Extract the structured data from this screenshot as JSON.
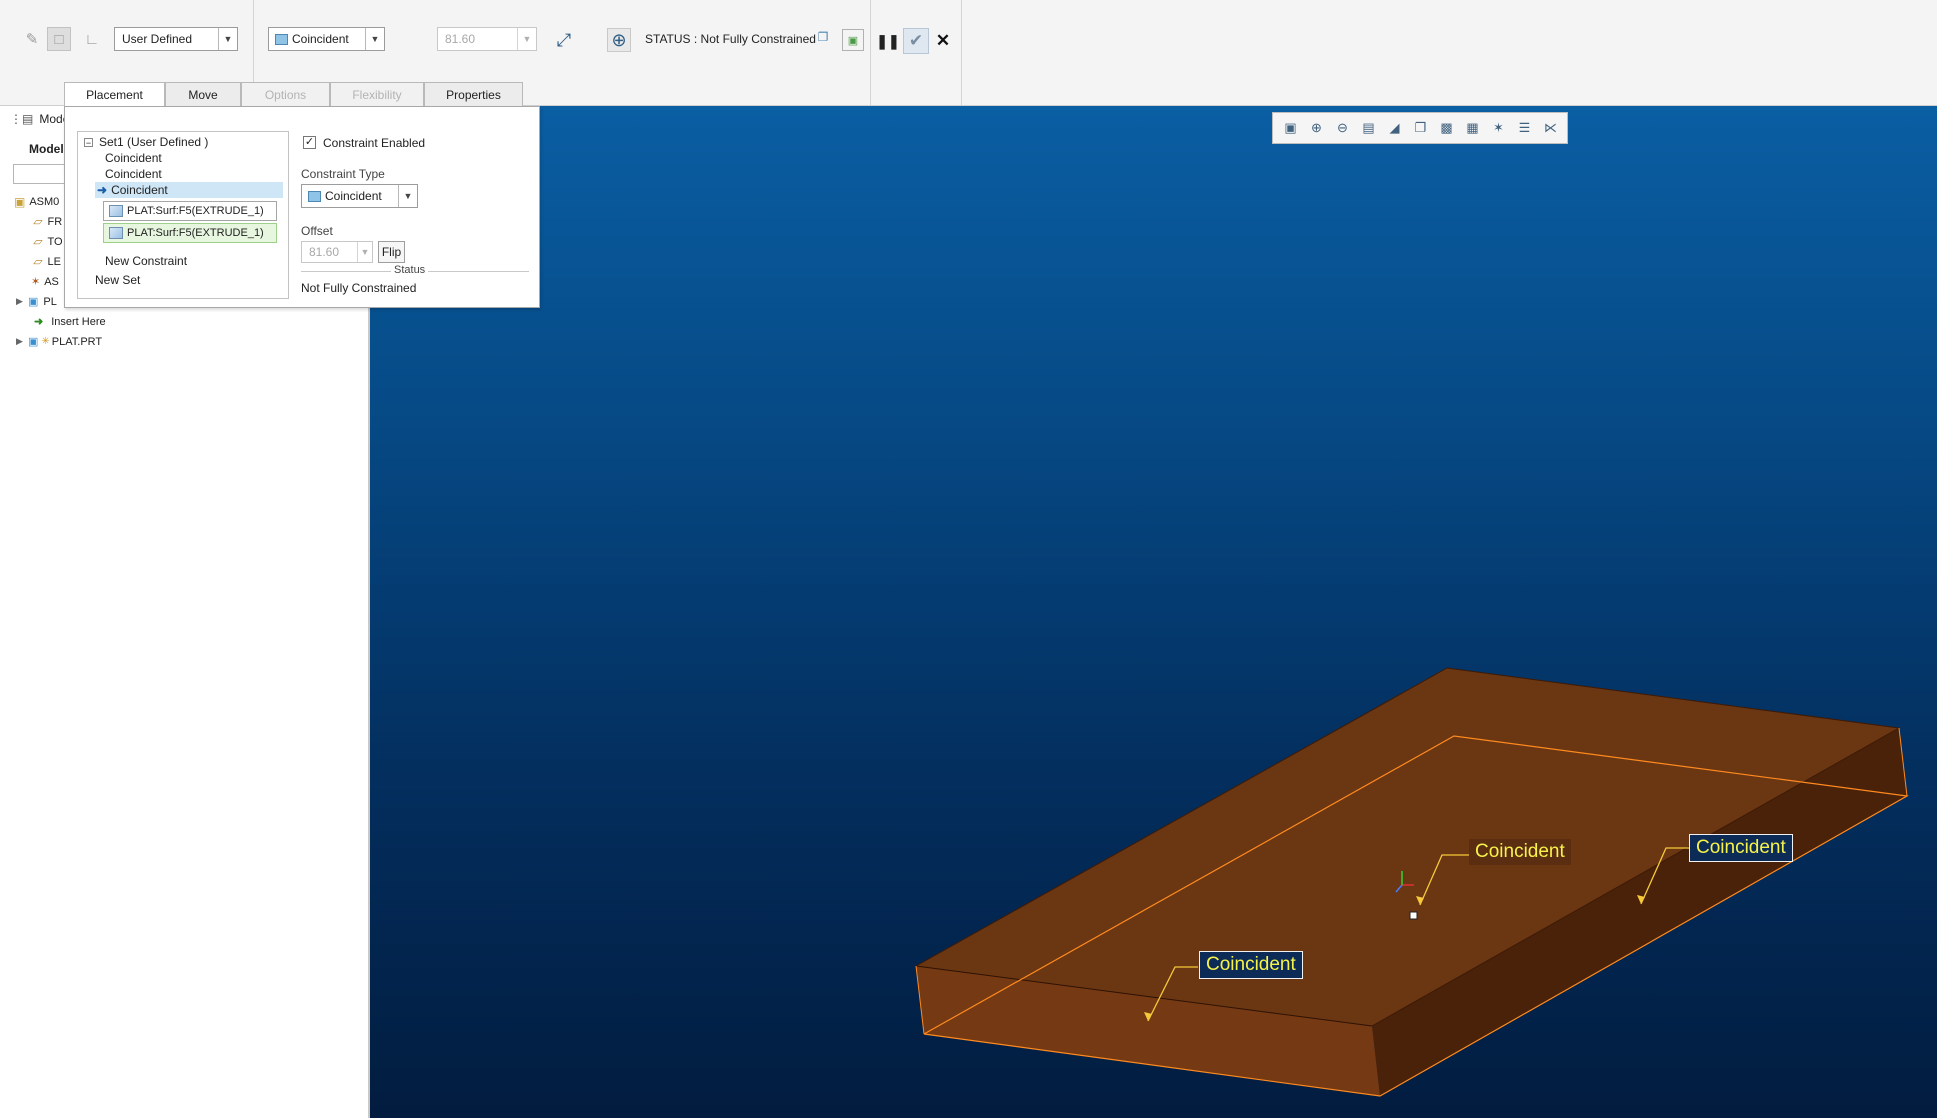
{
  "ribbon": {
    "set_type_dropdown": "User Defined",
    "constraint_type_dropdown": "Coincident",
    "offset_value": "81.60",
    "status": "STATUS : Not Fully Constrained"
  },
  "tabs": [
    {
      "label": "Placement"
    },
    {
      "label": "Move"
    },
    {
      "label": "Options"
    },
    {
      "label": "Flexibility"
    },
    {
      "label": "Properties"
    }
  ],
  "model_tree": {
    "header": "Model",
    "subheader": "Model",
    "items": [
      {
        "label": "ASM0"
      },
      {
        "label": "FR"
      },
      {
        "label": "TO"
      },
      {
        "label": "LE"
      },
      {
        "label": "AS"
      },
      {
        "label": "PL"
      },
      {
        "label": "Insert Here"
      },
      {
        "label": "PLAT.PRT"
      }
    ]
  },
  "placement_panel": {
    "set_title": "Set1 (User Defined )",
    "constraints": [
      "Coincident",
      "Coincident",
      "Coincident"
    ],
    "references": [
      "PLAT:Surf:F5(EXTRUDE_1)",
      "PLAT:Surf:F5(EXTRUDE_1)"
    ],
    "new_constraint": "New Constraint",
    "new_set": "New Set",
    "constraint_enabled_label": "Constraint Enabled",
    "constraint_enabled": true,
    "constraint_type_label": "Constraint Type",
    "constraint_type_value": "Coincident",
    "offset_label": "Offset",
    "offset_value": "81.60",
    "flip_label": "Flip",
    "status_label": "Status",
    "status_value": "Not Fully Constrained"
  },
  "viewport": {
    "callouts": [
      "Coincident",
      "Coincident",
      "Coincident"
    ],
    "part_color": "#6b3612",
    "edge_color": "#ff8a1f"
  },
  "colors": {
    "accent": "#2f7bbf",
    "selected_row": "#cfe6f6",
    "callout_text": "#f6f24a"
  }
}
